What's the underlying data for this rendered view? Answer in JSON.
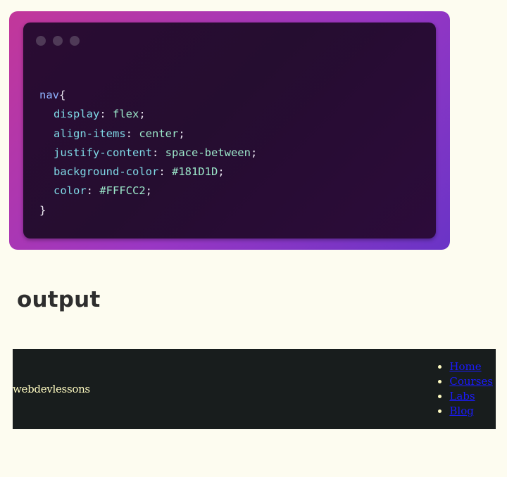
{
  "code_window": {
    "dots": [
      "window-dot",
      "window-dot",
      "window-dot"
    ],
    "lines": {
      "selector": "nav",
      "open_brace": "{",
      "decl1_prop": "display",
      "decl1_value": "flex",
      "decl2_prop": "align-items",
      "decl2_value": "center",
      "decl3_prop": "justify-content",
      "decl3_value": "space-between",
      "decl4_prop": "background-color",
      "decl4_value": "#181D1D",
      "decl5_prop": "color",
      "decl5_value": "#FFFCC2",
      "close_brace": "}"
    },
    "colors": {
      "frame_gradient": [
        "#c2379a",
        "#9a37c4",
        "#6a34c6"
      ],
      "window_bg": "#250d30"
    }
  },
  "output": {
    "heading": "output"
  },
  "nav_preview": {
    "brand": "webdevlessons",
    "links": [
      "Home",
      "Courses",
      "Labs",
      "Blog"
    ],
    "colors": {
      "background": "#181D1D",
      "text": "#FFFCC2",
      "link": "#1a1aff"
    }
  }
}
